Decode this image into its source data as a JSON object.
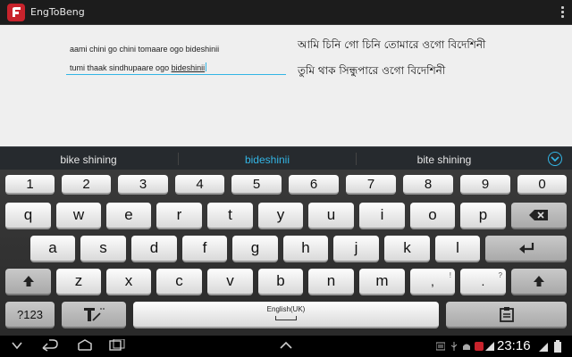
{
  "app": {
    "title": "EngToBeng",
    "brand_color": "#c8232c",
    "icon": "app-logo-icon"
  },
  "editor": {
    "line1": "aami chini go chini tomaare ogo bideshinii",
    "line2_prefix": "tumi thaak sindhupaare ogo ",
    "line2_composing": "bideshinii",
    "accent_color": "#33b5e5"
  },
  "output": {
    "line1": "আমি চিনি গো চিনি তোমারে ওগো বিদেশিনী",
    "line2": "তুমি থাক সিন্ধুপারে ওগো বিদেশিনী"
  },
  "suggestions": {
    "left": "bike shining",
    "center": "bideshinii",
    "right": "bite shining",
    "expand_icon": "chevron-down-icon"
  },
  "keyboard": {
    "numbers": [
      "1",
      "2",
      "3",
      "4",
      "5",
      "6",
      "7",
      "8",
      "9",
      "0"
    ],
    "row1": [
      "q",
      "w",
      "e",
      "r",
      "t",
      "y",
      "u",
      "i",
      "o",
      "p"
    ],
    "row2": [
      "a",
      "s",
      "d",
      "f",
      "g",
      "h",
      "j",
      "k",
      "l"
    ],
    "row3": [
      "z",
      "x",
      "c",
      "v",
      "b",
      "n",
      "m"
    ],
    "punct1": {
      "main": ",",
      "sub": "!"
    },
    "punct2": {
      "main": ".",
      "sub": "?"
    },
    "symbols_label": "?123",
    "space_label": "English(UK)"
  },
  "statusbar": {
    "time": "23:16"
  }
}
